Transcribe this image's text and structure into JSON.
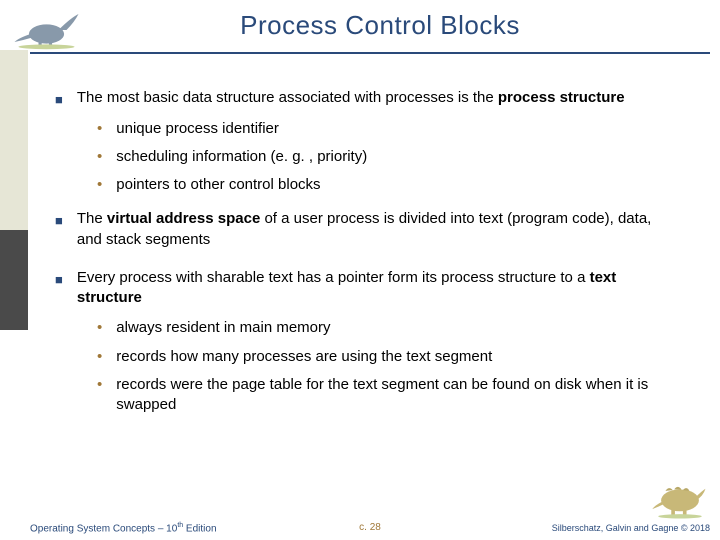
{
  "title": "Process Control Blocks",
  "bullets": [
    {
      "pre": "The most basic data structure associated with processes is the ",
      "bold": "process structure",
      "post": "",
      "subs": [
        "unique process identifier",
        "scheduling information (e. g. , priority)",
        "pointers to other control blocks"
      ]
    },
    {
      "pre": "The ",
      "bold": "virtual address space",
      "post": " of a user process is divided into text (program code), data, and stack segments",
      "subs": []
    },
    {
      "pre": "Every process with sharable text has a pointer form its process structure to a ",
      "bold": "text structure",
      "post": "",
      "subs": [
        "always resident in main memory",
        "records how many processes are using the text segment",
        "records were the page table for the text segment can be found on disk when it is swapped"
      ]
    }
  ],
  "footer": {
    "left_pre": "Operating System Concepts – 10",
    "left_sup": "th",
    "left_post": " Edition",
    "center": "c. 28",
    "right": "Silberschatz, Galvin and Gagne © 2018"
  }
}
